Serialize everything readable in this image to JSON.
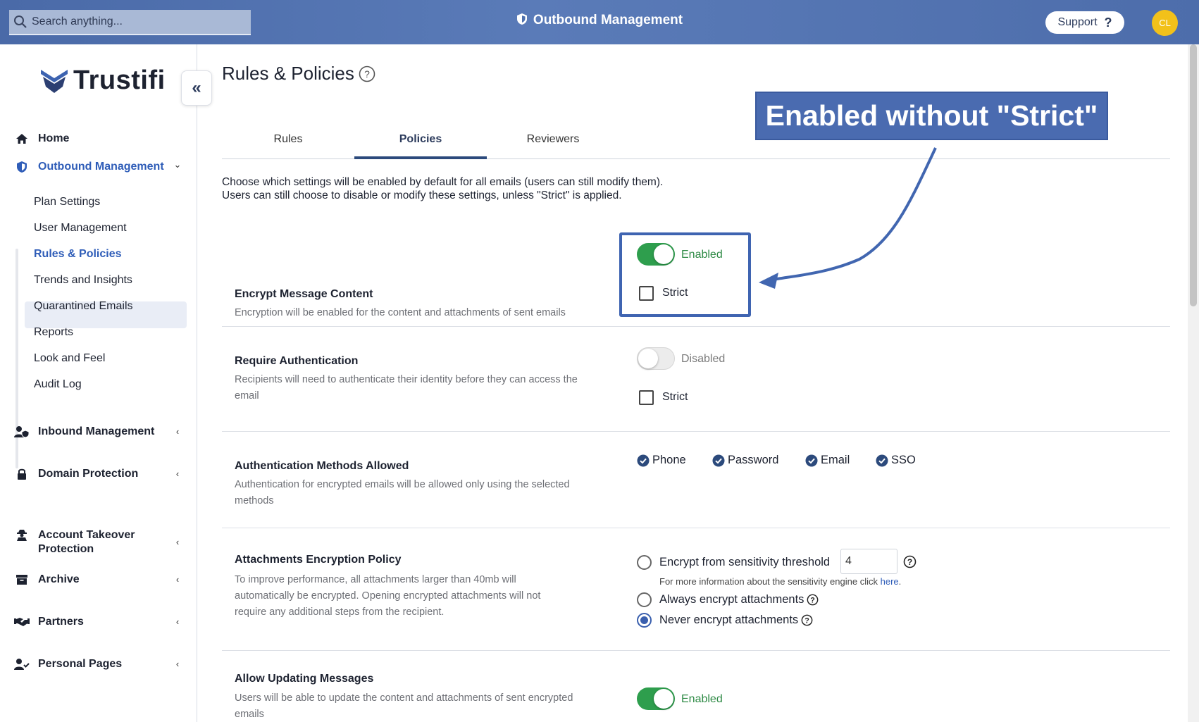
{
  "topbar": {
    "search_placeholder": "Search anything...",
    "title": "Outbound Management",
    "support_label": "Support",
    "support_icon": "?",
    "avatar_initials": "CL"
  },
  "sidebar": {
    "logo_text": "Trustifi",
    "collapse_icon": "«",
    "nav": [
      {
        "label": "Home",
        "icon": "home-icon"
      },
      {
        "label": "Outbound Management",
        "icon": "shield-icon",
        "chevron": "⌄"
      },
      {
        "label": "Inbound Management",
        "icon": "user-shield-icon",
        "chevron": "‹"
      },
      {
        "label": "Domain Protection",
        "icon": "lock-icon",
        "chevron": "‹"
      },
      {
        "label": "Account Takeover Protection",
        "icon": "user-secret-icon",
        "chevron": "‹"
      },
      {
        "label": "Archive",
        "icon": "archive-icon",
        "chevron": "‹"
      },
      {
        "label": "Partners",
        "icon": "handshake-icon",
        "chevron": "‹"
      },
      {
        "label": "Personal Pages",
        "icon": "user-check-icon",
        "chevron": "‹"
      }
    ],
    "subnav": [
      "Plan Settings",
      "User Management",
      "Rules & Policies",
      "Trends and Insights",
      "Quarantined Emails",
      "Reports",
      "Look and Feel",
      "Audit Log"
    ]
  },
  "main": {
    "title": "Rules & Policies",
    "tabs": [
      "Rules",
      "Policies",
      "Reviewers"
    ],
    "intro_line1": "Choose which settings will be enabled by default for all emails (users can still modify them).",
    "intro_line2": "Users can still choose to disable or modify these settings, unless \"Strict\" is applied.",
    "sections": {
      "encrypt": {
        "title": "Encrypt Message Content",
        "desc": "Encryption will be enabled for the content and attachments of sent emails",
        "toggle_label": "Enabled",
        "strict_label": "Strict"
      },
      "auth": {
        "title": "Require Authentication",
        "desc": "Recipients will need to authenticate their identity before they can access the email",
        "toggle_label": "Disabled",
        "strict_label": "Strict"
      },
      "methods": {
        "title": "Authentication Methods Allowed",
        "desc": "Authentication for encrypted emails will be allowed only using the selected methods",
        "options": [
          "Phone",
          "Password",
          "Email",
          "SSO"
        ]
      },
      "attachments": {
        "title": "Attachments Encryption Policy",
        "desc": "To improve performance, all attachments larger than 40mb will automatically be encrypted. Opening encrypted attachments will not require any additional steps from the recipient.",
        "opt_threshold": "Encrypt from sensitivity threshold",
        "threshold_value": "4",
        "note": "For more information about the sensitivity engine click",
        "note_link": "here",
        "opt_always": "Always encrypt attachments",
        "opt_never": "Never encrypt attachments",
        "selected": "never"
      },
      "updating": {
        "title": "Allow Updating Messages",
        "desc": "Users will be able to update the content and attachments of sent encrypted emails",
        "toggle_label": "Enabled"
      }
    }
  },
  "callout": {
    "text": "Enabled without \"Strict\""
  },
  "colors": {
    "topbar": "#4a6aa8",
    "accent": "#2f5db8",
    "toggle_on": "#2e9e4d",
    "callout": "#4a6bb0"
  }
}
